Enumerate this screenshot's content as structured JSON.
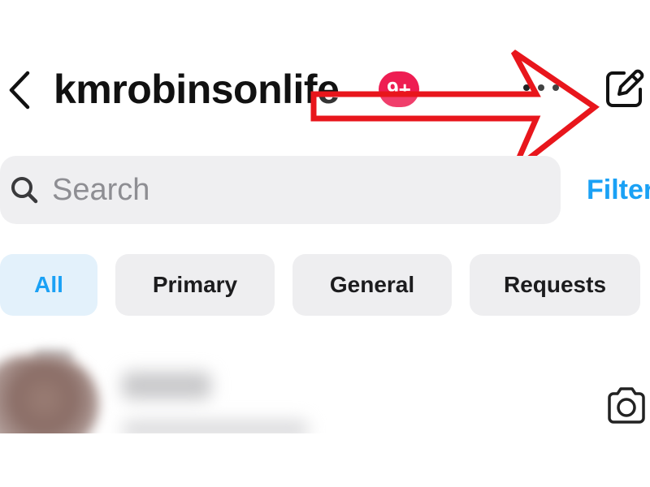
{
  "header": {
    "username": "kmrobinsonlife",
    "badge": "9+",
    "back_icon": "chevron-left-icon",
    "more_icon": "ellipsis-icon",
    "compose_icon": "compose-icon"
  },
  "search": {
    "placeholder": "Search",
    "value": "",
    "icon": "search-icon"
  },
  "filter_label": "Filter",
  "tabs": [
    {
      "label": "All",
      "active": true
    },
    {
      "label": "Primary",
      "active": false
    },
    {
      "label": "General",
      "active": false
    },
    {
      "label": "Requests",
      "active": false
    }
  ],
  "conversation": {
    "camera_icon": "camera-icon"
  },
  "colors": {
    "accent": "#1aa1f5",
    "badge": "#ee1d52",
    "annotation": "#e8161c",
    "tab_bg": "#eeeef0",
    "tab_active_bg": "#e3f1fb",
    "search_bg": "#efeff1"
  }
}
